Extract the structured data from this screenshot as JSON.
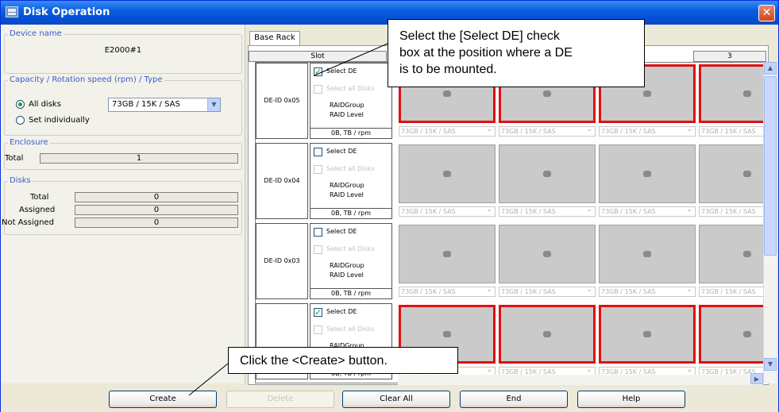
{
  "window": {
    "title": "Disk Operation",
    "close_glyph": "✕"
  },
  "left": {
    "device_group_title": "Device name",
    "device_name": "E2000#1",
    "capacity_group_title": "Capacity / Rotation speed (rpm) / Type",
    "all_disks_label": "All disks",
    "set_individually_label": "Set individually",
    "capacity_value": "73GB / 15K / SAS",
    "enclosure_group_title": "Enclosure",
    "enclosure_total_label": "Total",
    "enclosure_total_value": "1",
    "disks_group_title": "Disks",
    "disks_total_label": "Total",
    "disks_total_value": "0",
    "disks_assigned_label": "Assigned",
    "disks_assigned_value": "0",
    "disks_not_assigned_label": "Not Assigned",
    "disks_not_assigned_value": "0"
  },
  "rack": {
    "tab_label": "Base Rack",
    "slot_header": "Slot",
    "column_3": "3",
    "disk_option": "73GB / 15K / SAS",
    "select_de": "Select DE",
    "select_all_disks": "Select all Disks",
    "raid_group": "RAIDGroup",
    "raid_level": "RAID Level",
    "capacity_foot": "0B, TB / rpm",
    "rows": [
      {
        "id": "DE-ID 0x05",
        "selected": true
      },
      {
        "id": "DE-ID 0x04",
        "selected": false
      },
      {
        "id": "DE-ID 0x03",
        "selected": false
      },
      {
        "id": "",
        "selected": true
      }
    ]
  },
  "buttons": {
    "create": "Create",
    "delete": "Delete",
    "clear_all": "Clear All",
    "end": "End",
    "help": "Help"
  },
  "callouts": {
    "select_de_lines": [
      "Select the [Select DE] check",
      "box at the position where a DE",
      "is to be mounted."
    ],
    "create": "Click the <Create> button."
  }
}
